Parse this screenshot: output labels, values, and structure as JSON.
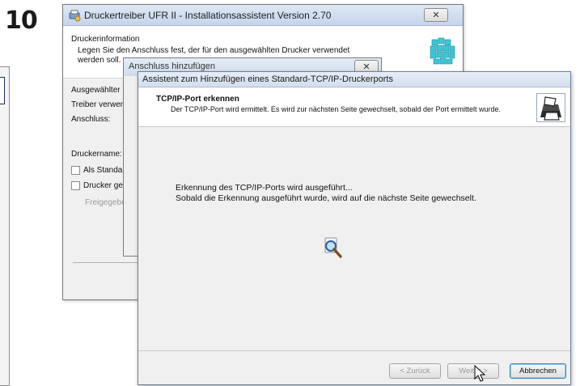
{
  "step_number": "10",
  "installer": {
    "title": "Druckertreiber UFR II - Installationsassistent Version 2.70",
    "close_glyph": "✕",
    "header_title": "Druckerinformation",
    "header_desc": "Legen Sie den Anschluss fest, der für den ausgewählten Drucker verwendet werden soll.",
    "labels": {
      "selected": "Ausgewählter",
      "driver": "Treiber verwen",
      "port": "Anschluss:",
      "printer_name": "Druckername:",
      "set_default": "Als Standar",
      "share": "Drucker ge",
      "share_name": "Freigegebe"
    }
  },
  "add_port_dialog": {
    "title": "Anschluss hinzufügen",
    "close_glyph": "✕"
  },
  "wizard": {
    "title": "Assistent zum Hinzufügen eines Standard-TCP/IP-Druckerports",
    "header_title": "TCP/IP-Port erkennen",
    "header_desc": "Der TCP/IP-Port wird ermittelt. Es wird zur nächsten Seite gewechselt, sobald der Port ermittelt wurde.",
    "body_line1": "Erkennung des TCP/IP-Ports wird ausgeführt...",
    "body_line2": "Sobald die Erkennung ausgeführt wurde, wird auf die nächste Seite gewechselt.",
    "buttons": {
      "back": "< Zurück",
      "next": "Weiter >",
      "cancel": "Abbrechen"
    }
  },
  "icons": {
    "installer_title": "printer-wizard-icon",
    "installer_logo": "cube-logo-icon",
    "wizard_logo": "printer-icon",
    "search": "magnifier-search-icon",
    "cursor": "mouse-pointer-icon"
  },
  "colors": {
    "logo_cyan": "#3fc6d6",
    "title_bar": "#dfe9f5",
    "default_button_border": "#3c7fb1"
  }
}
